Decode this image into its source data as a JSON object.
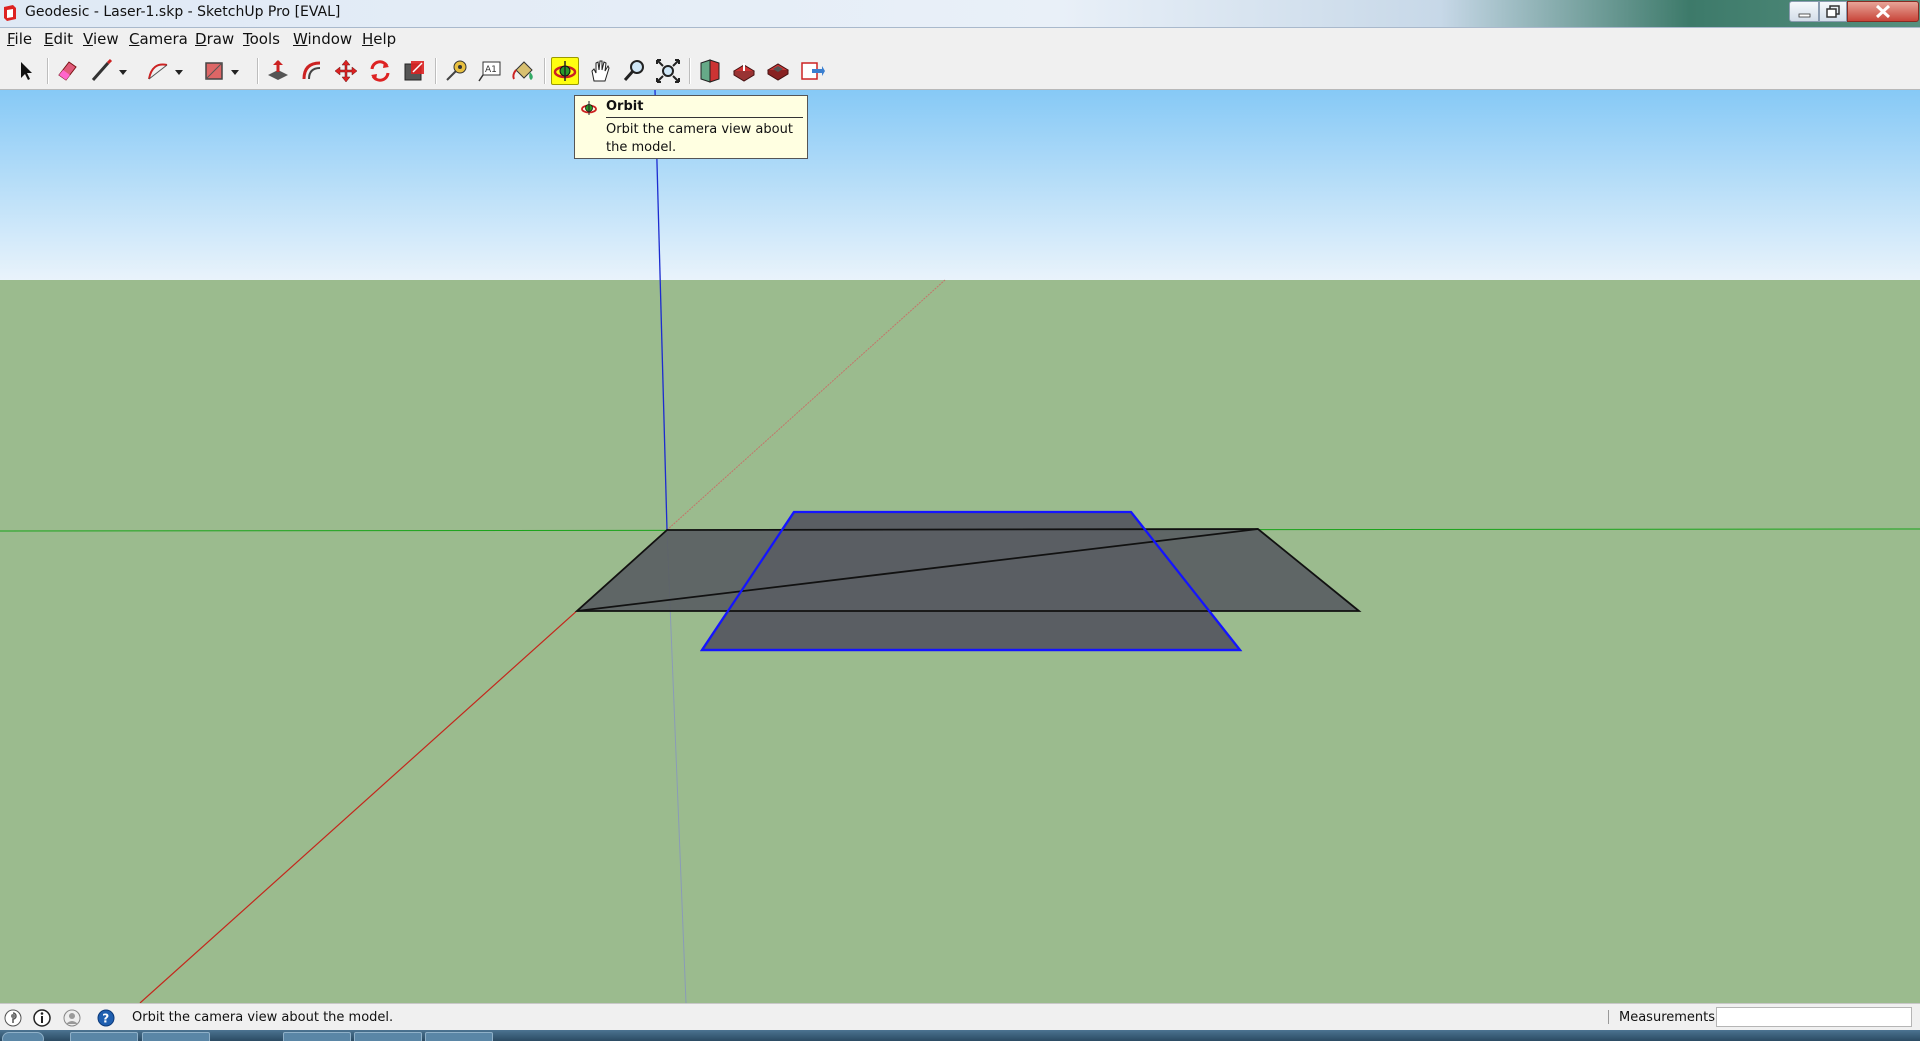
{
  "window": {
    "title": "Geodesic - Laser-1.skp - SketchUp Pro [EVAL]",
    "icon": "sketchup-logo-icon"
  },
  "menubar": {
    "items": [
      {
        "label": "File"
      },
      {
        "label": "Edit"
      },
      {
        "label": "View"
      },
      {
        "label": "Camera"
      },
      {
        "label": "Draw"
      },
      {
        "label": "Tools"
      },
      {
        "label": "Window"
      },
      {
        "label": "Help"
      }
    ]
  },
  "toolbar": {
    "tools": [
      {
        "name": "select-tool-icon"
      },
      {
        "name": "eraser-tool-icon"
      },
      {
        "name": "line-tool-icon",
        "has_dropdown": true
      },
      {
        "name": "arc-tool-icon",
        "has_dropdown": true
      },
      {
        "name": "rectangle-tool-icon",
        "has_dropdown": true
      },
      {
        "name": "push-pull-tool-icon"
      },
      {
        "name": "offset-tool-icon"
      },
      {
        "name": "move-tool-icon"
      },
      {
        "name": "rotate-tool-icon"
      },
      {
        "name": "scale-tool-icon"
      },
      {
        "name": "tape-measure-tool-icon"
      },
      {
        "name": "text-tool-icon"
      },
      {
        "name": "paint-bucket-tool-icon"
      },
      {
        "name": "orbit-tool-icon",
        "active": true
      },
      {
        "name": "pan-tool-icon"
      },
      {
        "name": "zoom-tool-icon"
      },
      {
        "name": "zoom-extents-tool-icon"
      },
      {
        "name": "3d-warehouse-icon"
      },
      {
        "name": "share-model-icon"
      },
      {
        "name": "share-component-icon"
      },
      {
        "name": "extension-warehouse-icon"
      }
    ],
    "active_highlight_color": "#ffff10"
  },
  "tooltip": {
    "title": "Orbit",
    "description": "Orbit the camera view about the model.",
    "icon": "orbit-icon"
  },
  "scene": {
    "sky_top_color": "#86c9f6",
    "sky_bottom_color": "#e9f3fb",
    "ground_color": "#9bbb8e",
    "face_color": "#5a5e63",
    "selection_color": "#0000ff",
    "axis_colors": {
      "red": "#c4271c",
      "green": "#1aa31a",
      "blue": "#1c2bd0"
    }
  },
  "statusbar": {
    "icons": [
      "geo-location-icon",
      "credits-icon",
      "user-icon",
      "help-icon"
    ],
    "text": "Orbit the camera view about the model.",
    "measurements_label": "Measurements",
    "measurements_value": ""
  }
}
